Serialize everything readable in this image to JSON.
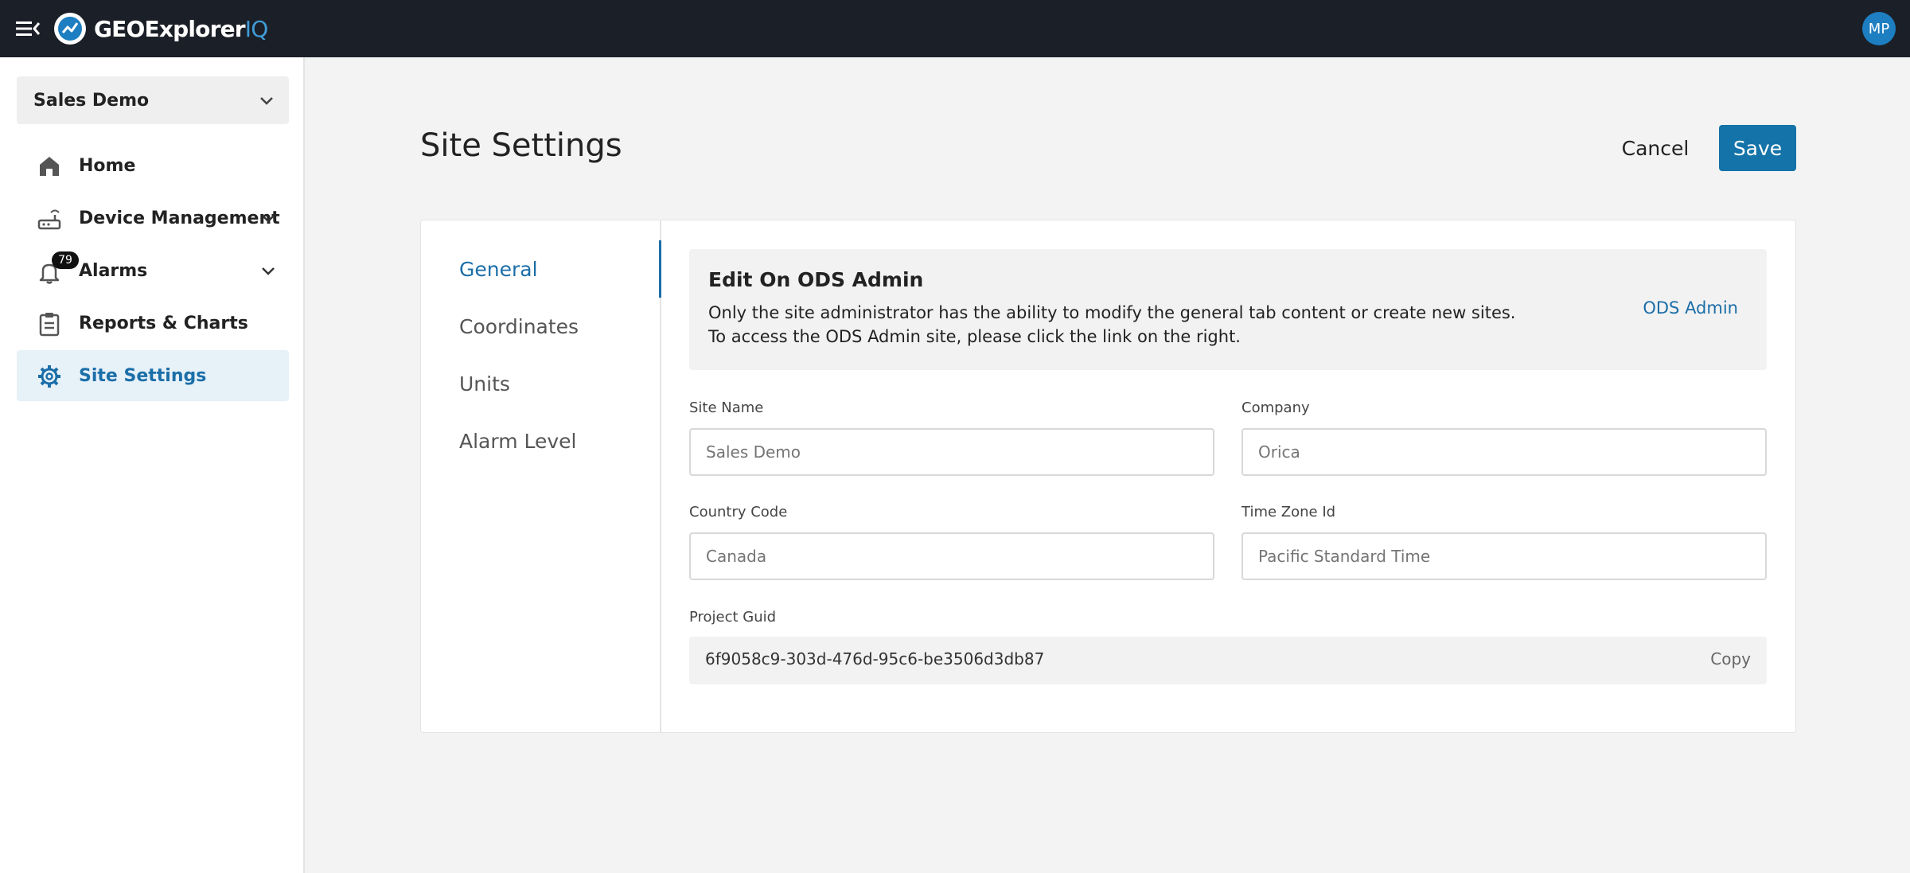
{
  "app": {
    "logo_main": "GEOExplorer",
    "logo_accent": "IQ",
    "user_initials": "MP"
  },
  "sidebar": {
    "site_selector": "Sales Demo",
    "items": [
      {
        "label": "Home",
        "icon": "home-icon"
      },
      {
        "label": "Device Management",
        "icon": "router-icon"
      },
      {
        "label": "Alarms",
        "icon": "bell-icon",
        "badge": "79"
      },
      {
        "label": "Reports & Charts",
        "icon": "clipboard-icon"
      },
      {
        "label": "Site Settings",
        "icon": "gear-icon"
      }
    ]
  },
  "page": {
    "title": "Site Settings",
    "cancel_label": "Cancel",
    "save_label": "Save"
  },
  "tabs": [
    "General",
    "Coordinates",
    "Units",
    "Alarm Level"
  ],
  "notice": {
    "title": "Edit On ODS Admin",
    "line1": "Only the site administrator has the ability to modify the general tab content or create new sites.",
    "line2": "To access the ODS Admin site, please click the link on the right.",
    "link": "ODS Admin"
  },
  "form": {
    "site_name": {
      "label": "Site Name",
      "value": "Sales Demo"
    },
    "company": {
      "label": "Company",
      "value": "Orica"
    },
    "country_code": {
      "label": "Country Code",
      "value": "Canada"
    },
    "time_zone": {
      "label": "Time Zone Id",
      "value": "Pacific Standard Time"
    },
    "project_guid": {
      "label": "Project Guid",
      "value": "6f9058c9-303d-476d-95c6-be3506d3db87",
      "copy_label": "Copy"
    }
  },
  "colors": {
    "topbar": "#1b1f27",
    "accent": "#1b6ea8",
    "save_button": "#1473a8",
    "active_nav_bg": "#e6f1f8"
  }
}
